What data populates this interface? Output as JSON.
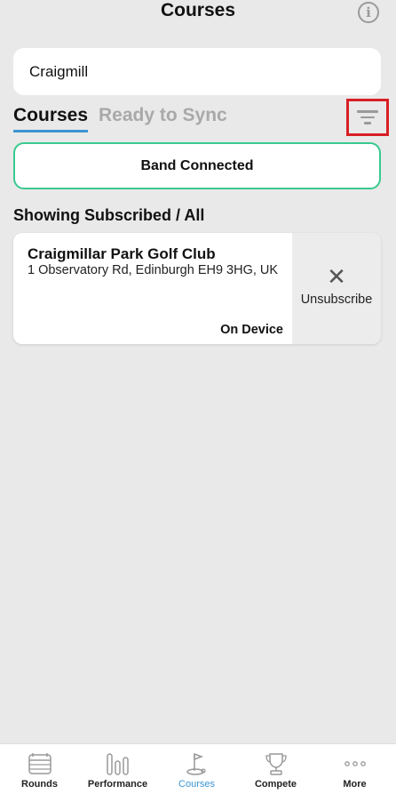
{
  "header": {
    "title": "Courses",
    "info_icon": "info-icon"
  },
  "search": {
    "value": "Craigmill"
  },
  "tabs": [
    {
      "label": "Courses",
      "active": true
    },
    {
      "label": "Ready to Sync",
      "active": false
    }
  ],
  "filter": {
    "icon": "filter-icon"
  },
  "band_status": {
    "label": "Band Connected",
    "border_color": "#39c98f"
  },
  "list": {
    "showing_label": "Showing Subscribed / All",
    "items": [
      {
        "name": "Craigmillar Park Golf Club",
        "address": "1 Observatory Rd, Edinburgh EH9 3HG, UK",
        "status": "On Device",
        "action_label": "Unsubscribe",
        "action_icon": "close-icon"
      }
    ]
  },
  "tabbar": {
    "items": [
      {
        "label": "Rounds",
        "icon": "scorecard-icon",
        "active": false
      },
      {
        "label": "Performance",
        "icon": "bar-chart-icon",
        "active": false
      },
      {
        "label": "Courses",
        "icon": "golf-flag-icon",
        "active": true
      },
      {
        "label": "Compete",
        "icon": "trophy-icon",
        "active": false
      },
      {
        "label": "More",
        "icon": "more-icon",
        "active": false
      }
    ]
  },
  "colors": {
    "accent": "#3b95d3",
    "highlight": "#d91f26",
    "background": "#e9e9e9"
  }
}
